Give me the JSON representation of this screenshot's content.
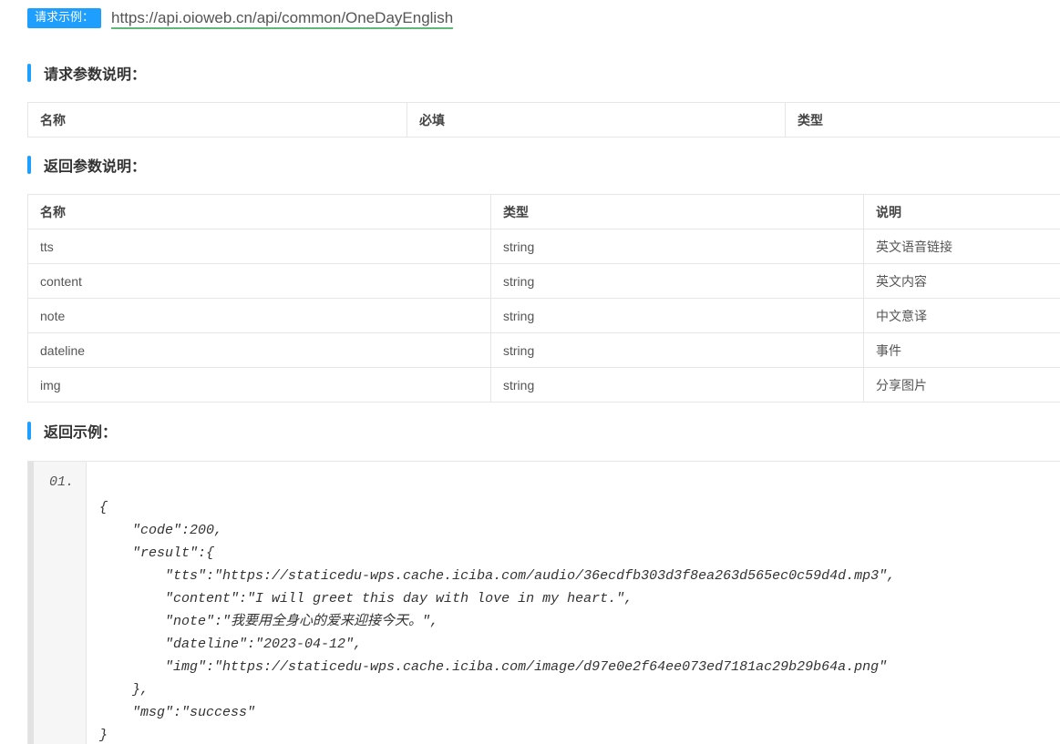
{
  "request": {
    "badge": "请求示例：",
    "url": "https://api.oioweb.cn/api/common/OneDayEnglish"
  },
  "request_params": {
    "title": "请求参数说明：",
    "headers": [
      "名称",
      "必填",
      "类型"
    ]
  },
  "response_params": {
    "title": "返回参数说明：",
    "headers": [
      "名称",
      "类型",
      "说明"
    ],
    "rows": [
      [
        "tts",
        "string",
        "英文语音链接"
      ],
      [
        "content",
        "string",
        "英文内容"
      ],
      [
        "note",
        "string",
        "中文意译"
      ],
      [
        "dateline",
        "string",
        "事件"
      ],
      [
        "img",
        "string",
        "分享图片"
      ]
    ]
  },
  "response_example": {
    "title": "返回示例：",
    "line_number": "01.",
    "code_lines": [
      "{",
      "    \"code\":200,",
      "    \"result\":{",
      "        \"tts\":\"https://staticedu-wps.cache.iciba.com/audio/36ecdfb303d3f8ea263d565ec0c59d4d.mp3\",",
      "        \"content\":\"I will greet this day with love in my heart.\",",
      "        \"note\":\"我要用全身心的爱来迎接今天。\",",
      "        \"dateline\":\"2023-04-12\",",
      "        \"img\":\"https://staticedu-wps.cache.iciba.com/image/d97e0e2f64ee073ed7181ac29b29b64a.png\"",
      "    },",
      "    \"msg\":\"success\"",
      "}"
    ]
  },
  "colors": {
    "accent": "#1e9fff",
    "link_underline": "#5fb878",
    "border": "#e6e6e6"
  }
}
